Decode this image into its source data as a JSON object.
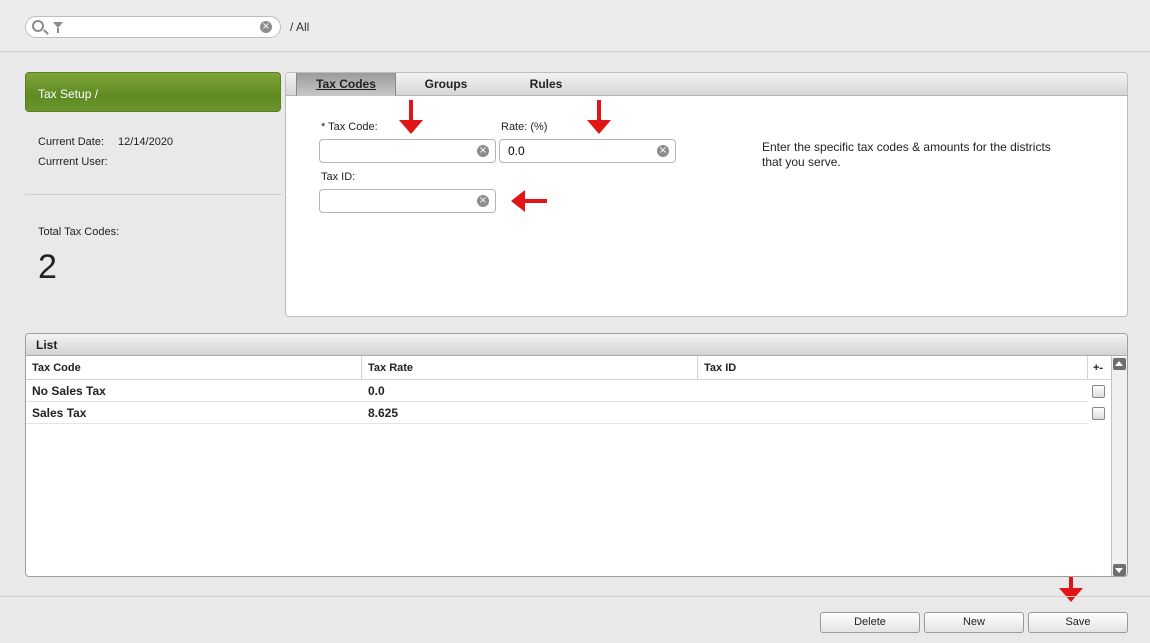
{
  "topbar": {
    "search_value": "",
    "breadcrumb": "/ All"
  },
  "sidebar": {
    "title": "Tax Setup /",
    "current_date_label": "Current Date:",
    "current_date_value": "12/14/2020",
    "current_user_label": "Currrent User:",
    "current_user_value": "",
    "total_label": "Total Tax Codes:",
    "total_value": "2"
  },
  "tabs": [
    {
      "label": "Tax Codes",
      "active": true
    },
    {
      "label": "Groups",
      "active": false
    },
    {
      "label": "Rules",
      "active": false
    }
  ],
  "form": {
    "tax_code_label": "* Tax Code:",
    "tax_code_value": "",
    "rate_label": "Rate: (%)",
    "rate_value": "0.0",
    "tax_id_label": "Tax ID:",
    "tax_id_value": "",
    "hint": "Enter the specific tax codes & amounts for the districts that you serve."
  },
  "list": {
    "title": "List",
    "columns": [
      "Tax Code",
      "Tax Rate",
      "Tax ID"
    ],
    "add_col_label": "+-",
    "rows": [
      {
        "code": "No Sales Tax",
        "rate": "0.0",
        "id": ""
      },
      {
        "code": "Sales Tax",
        "rate": "8.625",
        "id": ""
      }
    ]
  },
  "buttons": {
    "delete": "Delete",
    "new": "New",
    "save": "Save"
  },
  "colors": {
    "accent_green": "#6b952c",
    "annotation_red": "#e01616"
  },
  "icons": [
    "search-icon",
    "filter-icon",
    "clear-icon",
    "arrow-down-icon",
    "arrow-left-icon"
  ]
}
